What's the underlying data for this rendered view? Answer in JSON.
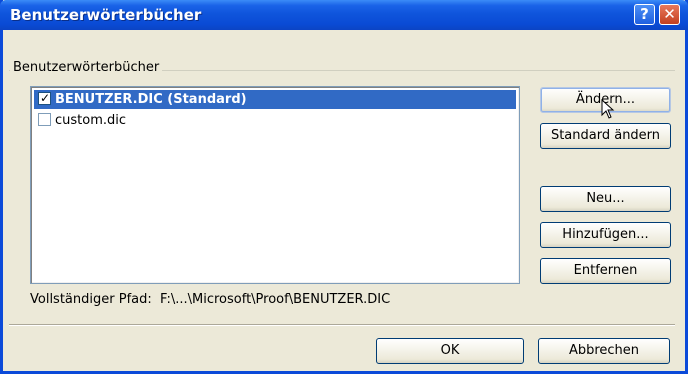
{
  "window": {
    "title": "Benutzerwörterbücher",
    "help_glyph": "?",
    "close_glyph": "✕"
  },
  "group": {
    "label": "Benutzerwörterbücher"
  },
  "list": {
    "items": [
      {
        "label": "BENUTZER.DIC (Standard)",
        "checked": true,
        "selected": true
      },
      {
        "label": "custom.dic",
        "checked": false,
        "selected": false
      }
    ]
  },
  "buttons": {
    "aendern": "Ändern...",
    "standard": "Standard ändern",
    "neu": "Neu...",
    "hinzu": "Hinzufügen...",
    "entfernen": "Entfernen",
    "ok": "OK",
    "cancel": "Abbrechen"
  },
  "path": {
    "label": "Vollständiger Pfad:",
    "value": "F:\\...\\Microsoft\\Proof\\BENUTZER.DIC"
  },
  "colors": {
    "titlebar": "#0a4bd5",
    "selection": "#316ac5",
    "dialog_bg": "#ece9d8"
  }
}
